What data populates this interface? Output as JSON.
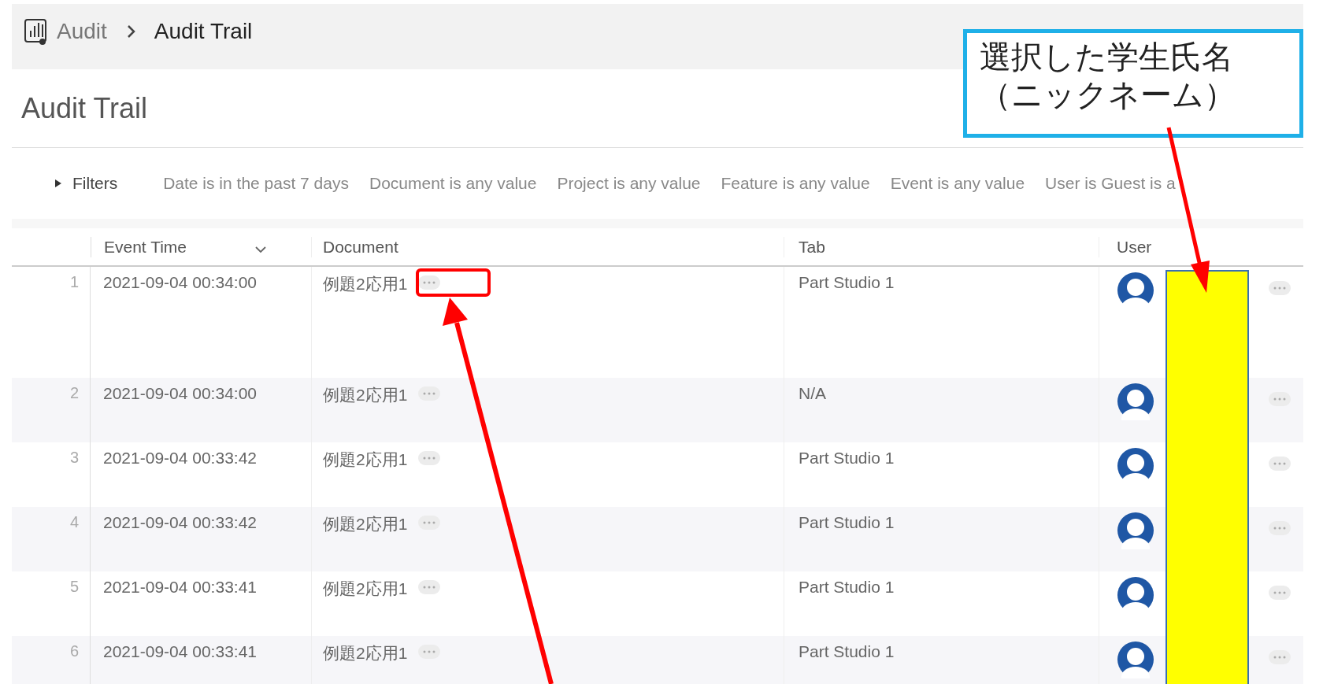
{
  "breadcrumb": {
    "parent": "Audit",
    "current": "Audit Trail"
  },
  "title": "Audit Trail",
  "filters": {
    "label": "Filters",
    "expanded": false,
    "items": [
      "Date is in the past 7 days",
      "Document is any value",
      "Project is any value",
      "Feature is any value",
      "Event is any value",
      "User is Guest is a"
    ]
  },
  "columns": [
    {
      "label": "Event Time",
      "sorted": true
    },
    {
      "label": "Document",
      "sorted": false
    },
    {
      "label": "Tab",
      "sorted": false
    },
    {
      "label": "User",
      "sorted": false
    }
  ],
  "rows": [
    {
      "index": "1",
      "event_time": "2021-09-04 00:34:00",
      "document": "例題2応用1",
      "tab": "Part Studio 1"
    },
    {
      "index": "2",
      "event_time": "2021-09-04 00:34:00",
      "document": "例題2応用1",
      "tab": "N/A"
    },
    {
      "index": "3",
      "event_time": "2021-09-04 00:33:42",
      "document": "例題2応用1",
      "tab": "Part Studio 1"
    },
    {
      "index": "4",
      "event_time": "2021-09-04 00:33:42",
      "document": "例題2応用1",
      "tab": "Part Studio 1"
    },
    {
      "index": "5",
      "event_time": "2021-09-04 00:33:41",
      "document": "例題2応用1",
      "tab": "Part Studio 1"
    },
    {
      "index": "6",
      "event_time": "2021-09-04 00:33:41",
      "document": "例題2応用1",
      "tab": "Part Studio 1"
    }
  ],
  "annotation": {
    "callout_lines": [
      "選択した学生氏名",
      "（ニックネーム）"
    ]
  }
}
